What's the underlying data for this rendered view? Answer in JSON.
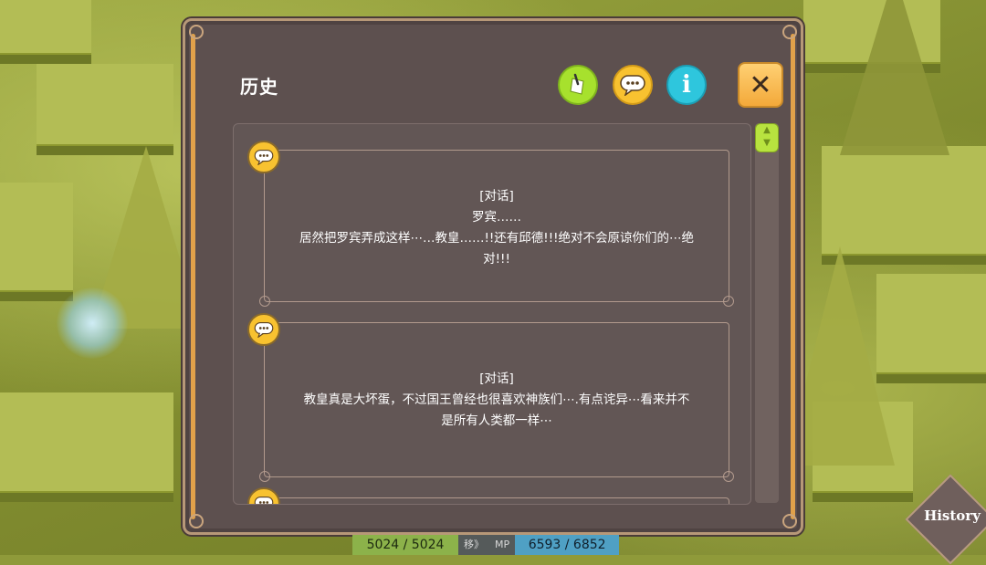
{
  "panel": {
    "title": "历史",
    "toolbar": {
      "note_icon": "note-icon",
      "chat_icon": "chat-bubble-icon",
      "info_icon": "info-icon",
      "info_glyph": "i",
      "close_glyph": "✕"
    },
    "entries": [
      {
        "icon": "chat-bubble-icon",
        "lines": [
          "[对话]",
          "罗宾……",
          "居然把罗宾弄成这样⋯…教皇……!!还有邱德!!!绝对不会原谅你们的⋯绝",
          "对!!!"
        ]
      },
      {
        "icon": "chat-bubble-icon",
        "lines": [
          "[对话]",
          "教皇真是大坏蛋，不过国王曾经也很喜欢神族们⋯.有点诧异⋯看来并不",
          "是所有人类都一样⋯"
        ]
      },
      {
        "icon": "chat-bubble-icon",
        "lines": []
      }
    ]
  },
  "hud": {
    "hp": "5024 / 5024",
    "hp_tag": "移》",
    "mp_label": "MP",
    "mp": "6593 / 6852"
  },
  "history_button": {
    "label": "History"
  },
  "colors": {
    "panel_bg": "#5d504f",
    "accent_orange": "#e1a14a",
    "chat_yellow": "#f8c230",
    "note_green": "#a7e12d",
    "info_cyan": "#2ec6dd"
  }
}
